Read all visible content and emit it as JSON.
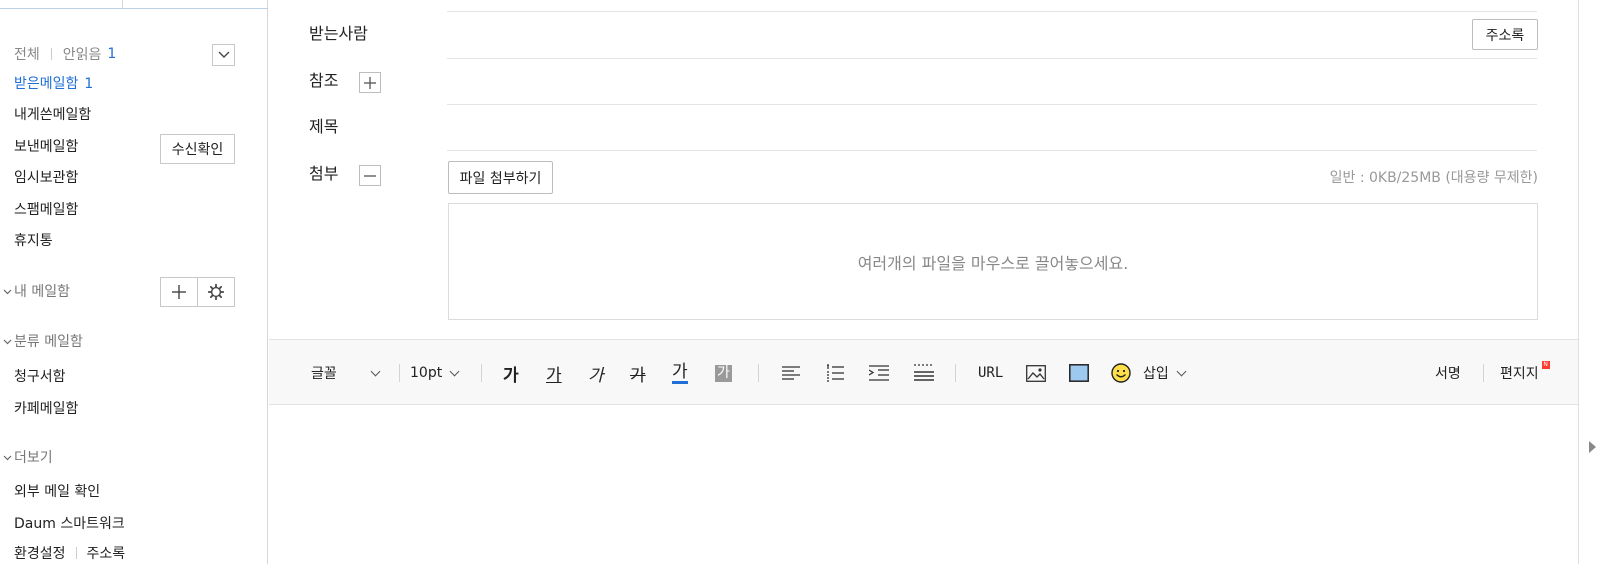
{
  "sidebar": {
    "filter": {
      "all_label": "전체",
      "unread_label": "안읽음",
      "unread_count": "1"
    },
    "mailboxes": [
      {
        "label": "받은메일함",
        "count": "1"
      },
      {
        "label": "내게쓴메일함"
      },
      {
        "label": "보낸메일함"
      },
      {
        "label": "임시보관함"
      },
      {
        "label": "스팸메일함"
      },
      {
        "label": "휴지통"
      }
    ],
    "read_receipt_button": "수신확인",
    "my_mailbox_label": "내 메일함",
    "category_label": "분류 메일함",
    "category_items": [
      {
        "label": "청구서함"
      },
      {
        "label": "카페메일함"
      }
    ],
    "more_label": "더보기",
    "more_items": [
      {
        "label": "외부 메일 확인"
      },
      {
        "label": "Daum 스마트워크"
      }
    ],
    "bottom_links": {
      "settings": "환경설정",
      "address_book": "주소록"
    }
  },
  "compose": {
    "to_label": "받는사람",
    "cc_label": "참조",
    "subject_label": "제목",
    "attach_label": "첨부",
    "address_book_button": "주소록",
    "attach_button": "파일 첨부하기",
    "quota_text": "일반 : 0KB/25MB (대용량 무제한)",
    "dropzone_text": "여러개의 파일을 마우스로 끌어놓으세요."
  },
  "toolbar": {
    "font_label": "글꼴",
    "size_label": "10pt",
    "bold_glyph": "가",
    "underline_glyph": "가",
    "italic_glyph": "가",
    "strike_glyph": "가",
    "color_glyph": "가",
    "bgcolor_glyph": "가",
    "url_label": "URL",
    "insert_label": "삽입",
    "signature_label": "서명",
    "stationery_label": "편지지",
    "stationery_badge": "N",
    "accent_color": "#1f6fd6"
  }
}
